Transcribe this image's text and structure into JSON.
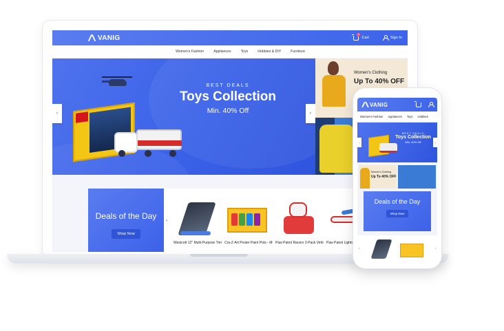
{
  "brand": {
    "name": "VANIG"
  },
  "header": {
    "cart_label": "Cart",
    "cart_count": "0",
    "signin_label": "Sign In"
  },
  "nav": {
    "items": [
      "Women's Fashion",
      "Appliances",
      "Toys",
      "Hobbies & DIY",
      "Furniture"
    ]
  },
  "hero": {
    "kicker": "BEST DEALS",
    "title": "Toys Collection",
    "subtitle": "Min. 40% Off"
  },
  "promo": {
    "line1": "Women's Clothing",
    "line2": "Up To 40% OFF"
  },
  "deals": {
    "title": "Deals of the Day",
    "button": "Shop Now"
  },
  "products": [
    {
      "name": "Westcott 12\" Multi-Purpose Trimmer"
    },
    {
      "name": "Cra-Z-Art Poster Paint Pots - Multi-Pack"
    },
    {
      "name": "Paw Patrol Racers 3-Pack Vehicle Set"
    },
    {
      "name": "Paw Patrol Lights and Sounds Air Patroller"
    }
  ],
  "mobile": {
    "nav": [
      "Women's Fashion",
      "Appliances",
      "Toys",
      "Hobbies"
    ],
    "hero": {
      "kicker": "BEST DEALS",
      "title": "Toys Collection",
      "subtitle": "Min. 40% Off"
    },
    "promo": {
      "line1": "Women's Clothing",
      "line2": "Up To 40% OFF"
    },
    "deals": {
      "title": "Deals of the Day",
      "button": "Shop Now"
    }
  },
  "colors": {
    "primary": "#3d64ea",
    "accent": "#5a7cf0",
    "badge": "#ff4d6d"
  }
}
